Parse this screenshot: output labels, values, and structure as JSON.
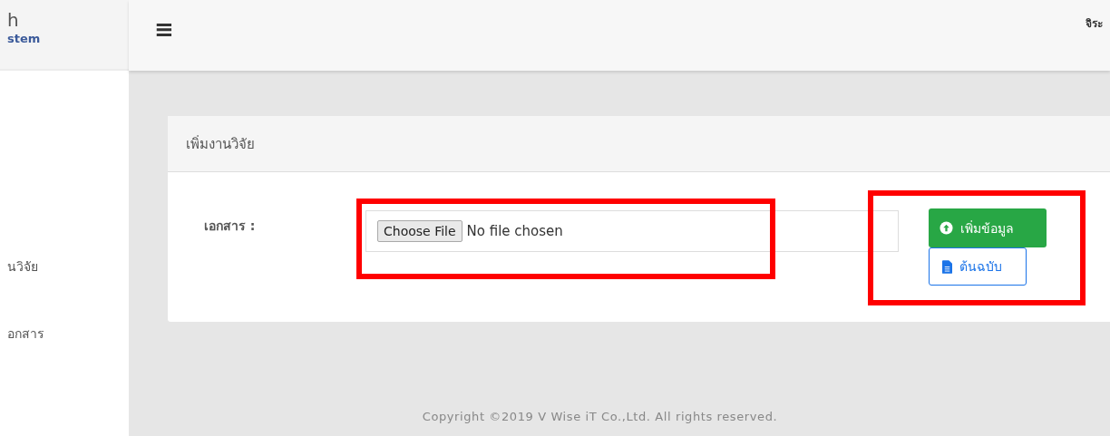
{
  "sidebar": {
    "logo_title": "h",
    "logo_subtitle": "stem",
    "items": [
      {
        "label": "นวิจัย",
        "selected": false
      },
      {
        "label": "อกสาร",
        "selected": false
      }
    ]
  },
  "topbar": {
    "menu_icon": "≡",
    "user_name": "จิระ"
  },
  "card": {
    "title": "เพิ่มงานวิจัย",
    "field_label": "เอกสาร :",
    "file_button": "Choose File",
    "file_status": "No file chosen",
    "buttons": [
      {
        "kind": "primary",
        "label": "เพิ่มข้อมูล"
      },
      {
        "kind": "outline",
        "label": "ต้นฉบับ"
      }
    ]
  },
  "annotations": {
    "file_field_framed": true,
    "buttons_framed": true
  },
  "footer": "Copyright ©2019 V Wise iT Co.,Ltd. All rights reserved."
}
